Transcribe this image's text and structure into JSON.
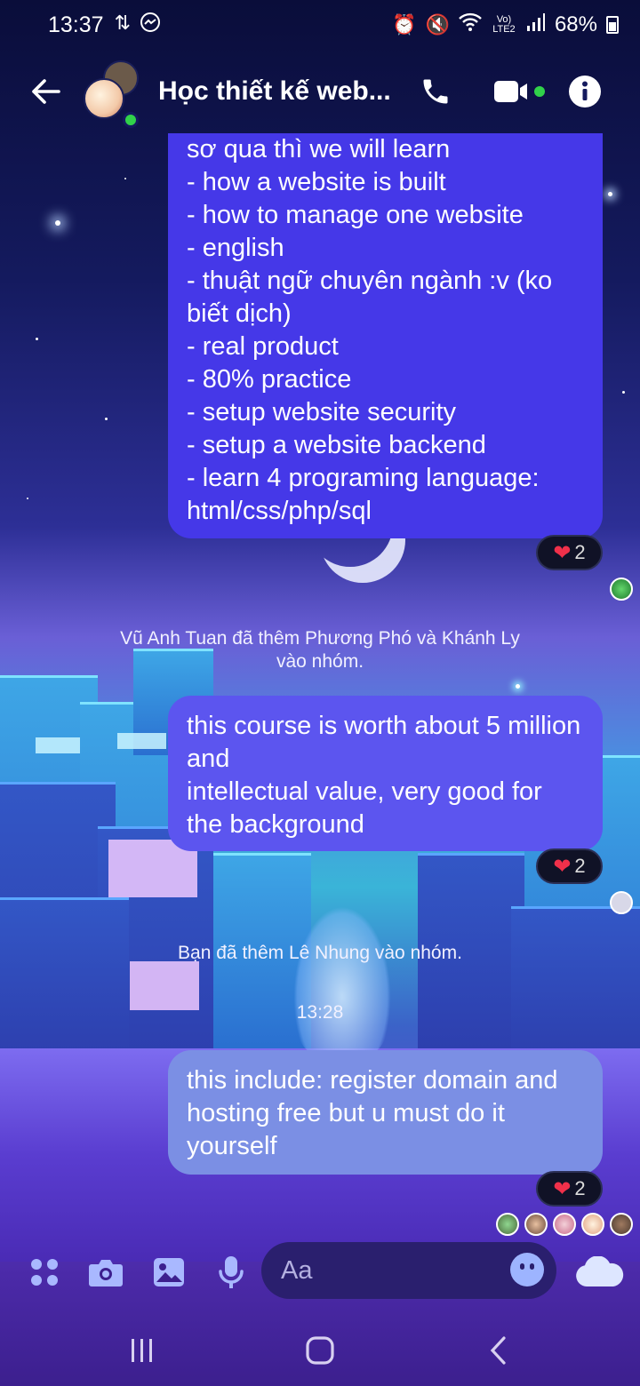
{
  "status_bar": {
    "time": "13:37",
    "network_label": "Vo) LTE2",
    "battery": "68%"
  },
  "header": {
    "title": "Học thiết kế web...",
    "icons": [
      "back-arrow-icon",
      "phone-icon",
      "video-camera-icon",
      "info-icon"
    ]
  },
  "messages": [
    {
      "text": "sơ qua thì we will learn\n- how a website is built\n- how to manage one website\n- english\n- thuật ngữ chuyên ngành :v (ko biết dịch)\n- real product\n- 80% practice\n- setup website security\n- setup a website backend\n- learn 4 programing language: html/css/php/sql",
      "reaction": {
        "emoji": "❤️",
        "count": "2"
      }
    },
    {
      "text": "this course is worth about 5 million and\nintellectual value, very good for the background",
      "reaction": {
        "emoji": "❤️",
        "count": "2"
      }
    },
    {
      "text": "this include: register domain and hosting free but u must do it yourself",
      "reaction": {
        "emoji": "❤️",
        "count": "2"
      }
    }
  ],
  "system_messages": [
    "Vũ Anh Tuan đã thêm Phương Phó và Khánh Ly\nvào nhóm.",
    "Bạn đã thêm Lê Nhung vào nhóm."
  ],
  "timestamp": "13:28",
  "composer": {
    "placeholder": "Aa",
    "icons": [
      "apps-icon",
      "camera-icon",
      "image-icon",
      "microphone-icon",
      "emoji-icon",
      "cloud-icon"
    ]
  },
  "colors": {
    "bubble_1": "#4538e8",
    "bubble_2": "#5c55ef",
    "bubble_3": "#7b8fe4",
    "accent": "#a9b8ff",
    "online": "#31d24a"
  }
}
